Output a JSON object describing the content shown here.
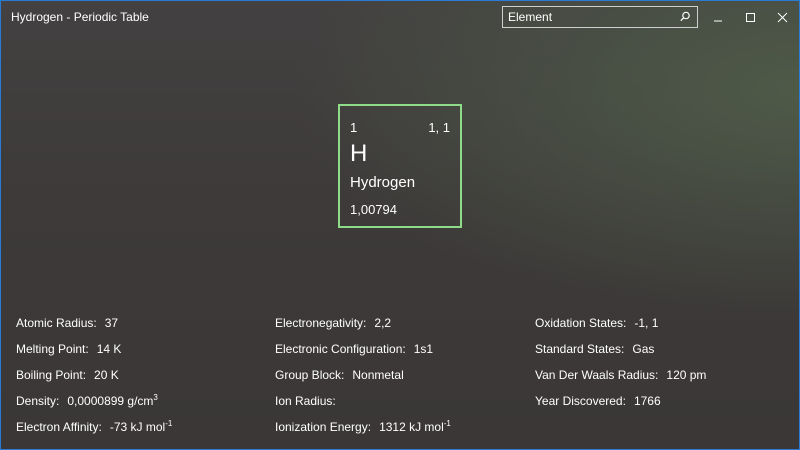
{
  "window": {
    "title": "Hydrogen - Periodic Table",
    "frame_color": "#2a7bd6",
    "controls": [
      "minimize-icon",
      "maximize-icon",
      "close-icon"
    ]
  },
  "search": {
    "value": "",
    "placeholder": "Element",
    "icon": "search-icon"
  },
  "element": {
    "atomic_number": "1",
    "position": "1, 1",
    "symbol": "H",
    "name": "Hydrogen",
    "atomic_mass": "1,00794",
    "border_color": "#8edc8a"
  },
  "properties": {
    "col1": [
      {
        "label": "Atomic Radius:",
        "value": "37"
      },
      {
        "label": "Melting Point:",
        "value": "14 K"
      },
      {
        "label": "Boiling Point:",
        "value": "20 K"
      },
      {
        "label": "Density:",
        "value": "0,0000899 g/cm",
        "sup": "3"
      },
      {
        "label": "Electron Affinity:",
        "value": "-73 kJ mol",
        "sup": "-1"
      }
    ],
    "col2": [
      {
        "label": "Electronegativity:",
        "value": "2,2"
      },
      {
        "label": "Electronic Configuration:",
        "value": "1s1"
      },
      {
        "label": "Group Block:",
        "value": "Nonmetal"
      },
      {
        "label": "Ion Radius:",
        "value": ""
      },
      {
        "label": "Ionization Energy:",
        "value": "1312 kJ mol",
        "sup": "-1"
      }
    ],
    "col3": [
      {
        "label": "Oxidation States:",
        "value": "-1, 1"
      },
      {
        "label": "Standard States:",
        "value": "Gas"
      },
      {
        "label": "Van Der Waals Radius:",
        "value": "120 pm"
      },
      {
        "label": "Year Discovered:",
        "value": "1766"
      }
    ]
  }
}
